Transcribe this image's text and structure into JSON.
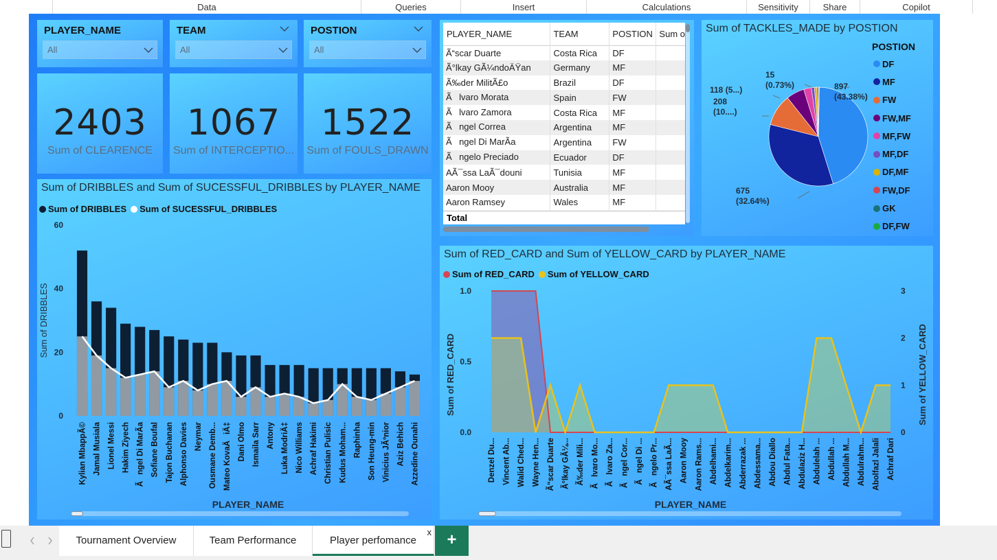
{
  "ribbon": {
    "items": [
      {
        "label": "Data"
      },
      {
        "label": "Queries"
      },
      {
        "label": "Insert"
      },
      {
        "label": "Calculations"
      },
      {
        "label": "Sensitivity"
      },
      {
        "label": "Share"
      },
      {
        "label": "Copilot"
      }
    ]
  },
  "slicers": [
    {
      "title": "PLAYER_NAME",
      "value": "All"
    },
    {
      "title": "TEAM",
      "value": "All"
    },
    {
      "title": "POSTION",
      "value": "All"
    }
  ],
  "cards": [
    {
      "value": "2403",
      "label": "Sum of CLEARENCE"
    },
    {
      "value": "1067",
      "label": "Sum of INTERCEPTIO..."
    },
    {
      "value": "1522",
      "label": "Sum of FOULS_DRAWN"
    }
  ],
  "table": {
    "headers": [
      "PLAYER_NAME",
      "TEAM",
      "POSTION",
      "Sum o"
    ],
    "rows": [
      [
        "Ã“scar Duarte",
        "Costa Rica",
        "DF"
      ],
      [
        "Ã°lkay GÃ¼ndoÄŸan",
        "Germany",
        "MF"
      ],
      [
        "Ã‰der MilitÃ£o",
        "Brazil",
        "DF"
      ],
      [
        "Ãlvaro Morata",
        "Spain",
        "FW"
      ],
      [
        "Ãlvaro Zamora",
        "Costa Rica",
        "MF"
      ],
      [
        "Ãngel Correa",
        "Argentina",
        "MF"
      ],
      [
        "Ãngel Di MarÃa",
        "Argentina",
        "FW"
      ],
      [
        "Ãngelo Preciado",
        "Ecuador",
        "DF"
      ],
      [
        "AÃ¯ssa LaÃ¯douni",
        "Tunisia",
        "MF"
      ],
      [
        "Aaron Mooy",
        "Australia",
        "MF"
      ],
      [
        "Aaron Ramsey",
        "Wales",
        "MF"
      ]
    ],
    "total_label": "Total"
  },
  "pie": {
    "title": "Sum of TACKLES_MADE by POSTION",
    "legend_title": "POSTION",
    "legend": [
      {
        "name": "DF",
        "color": "#2a8bf2"
      },
      {
        "name": "MF",
        "color": "#12239e"
      },
      {
        "name": "FW",
        "color": "#e66c37"
      },
      {
        "name": "FW,MF",
        "color": "#6b007b"
      },
      {
        "name": "MF,FW",
        "color": "#e044a7"
      },
      {
        "name": "MF,DF",
        "color": "#744ec2"
      },
      {
        "name": "DF,MF",
        "color": "#d9b300"
      },
      {
        "name": "FW,DF",
        "color": "#d64550"
      },
      {
        "name": "GK",
        "color": "#197278"
      },
      {
        "name": "DF,FW",
        "color": "#1aab40"
      }
    ],
    "labels": [
      {
        "line1": "897",
        "line2": "(43.38%)"
      },
      {
        "line1": "675",
        "line2": "(32.64%)"
      },
      {
        "line1": "208",
        "line2": "(10....)"
      },
      {
        "line1": "118 (5...)",
        "line2": ""
      },
      {
        "line1": "15",
        "line2": "(0.73%)"
      }
    ]
  },
  "bar_chart": {
    "title": "Sum of DRIBBLES and Sum of SUCESSFUL_DRIBBLES by PLAYER_NAME",
    "legend": [
      {
        "name": "Sum of DRIBBLES",
        "color": "#0d1f33"
      },
      {
        "name": "Sum of SUCESSFUL_DRIBBLES",
        "color": "#ffffff"
      }
    ],
    "ylabel": "Sum of DRIBBLES",
    "xlabel": "PLAYER_NAME",
    "yticks": [
      "60",
      "40",
      "20",
      "0"
    ]
  },
  "line_chart": {
    "title": "Sum of RED_CARD and Sum of YELLOW_CARD by PLAYER_NAME",
    "legend": [
      {
        "name": "Sum of RED_CARD",
        "color": "#d64550"
      },
      {
        "name": "Sum of YELLOW_CARD",
        "color": "#e8c21e"
      }
    ],
    "ylabel_left": "Sum of RED_CARD",
    "ylabel_right": "Sum of YELLOW_CARD",
    "xlabel": "PLAYER_NAME",
    "yticks_left": [
      "1.0",
      "0.5",
      "0.0"
    ],
    "yticks_right": [
      "3",
      "2",
      "1",
      "0"
    ]
  },
  "chart_data": [
    {
      "type": "bar",
      "title": "Sum of DRIBBLES and Sum of SUCESSFUL_DRIBBLES by PLAYER_NAME",
      "xlabel": "PLAYER_NAME",
      "ylabel": "Sum of DRIBBLES",
      "ylim": [
        0,
        60
      ],
      "categories": [
        "Kylian MbappÃ©",
        "Jamal Musiala",
        "Lionel Messi",
        "Hakim Ziyech",
        "Ãngel Di MarÃa",
        "Sofiane Boufal",
        "Tajon Buchanan",
        "Alphonso Davies",
        "Neymar",
        "Ousmane Demb...",
        "Mateo KovaÄiÄ‡",
        "Dani Olmo",
        "Ismaila Sarr",
        "Antony",
        "Luka ModriÄ‡",
        "Nico Williams",
        "Achraf Hakimi",
        "Christian Pulisic",
        "Kudus Moham...",
        "Raphinha",
        "Son Heung-min",
        "Vinicius JÃºnior",
        "Aziz Behich",
        "Azzedine Ounahi"
      ],
      "series": [
        {
          "name": "Sum of DRIBBLES",
          "values": [
            52,
            36,
            34,
            29,
            28,
            27,
            25,
            24,
            23,
            23,
            20,
            19,
            19,
            16,
            16,
            16,
            15,
            15,
            15,
            15,
            15,
            15,
            14,
            13
          ]
        },
        {
          "name": "Sum of SUCESSFUL_DRIBBLES",
          "values": [
            25,
            19,
            15,
            12,
            13,
            14,
            9,
            11,
            8,
            10,
            11,
            6,
            9,
            6,
            7,
            6,
            4,
            5,
            10,
            6,
            5,
            7,
            9,
            11
          ]
        }
      ]
    },
    {
      "type": "line",
      "title": "Sum of RED_CARD and Sum of YELLOW_CARD by PLAYER_NAME",
      "xlabel": "PLAYER_NAME",
      "ylabel": "Sum of RED_CARD",
      "ylabel_right": "Sum of YELLOW_CARD",
      "ylim": [
        0,
        1
      ],
      "ylim_right": [
        0,
        3
      ],
      "categories": [
        "Denzel Du...",
        "Vincent Ab...",
        "Walid Ched...",
        "Wayne Hen...",
        "Ã“scar Duarte",
        "Ã°lkay GÃ¼...",
        "Ã‰der Mili...",
        "Ãlvaro Mo...",
        "Ãlvaro Za...",
        "Ãngel Cor...",
        "Ãngel Di ...",
        "Ãngelo Pr...",
        "AÃ¯ssa LaÃ...",
        "Aaron Mooy",
        "Aaron Rams...",
        "Abdelhami...",
        "Abdelkarim...",
        "Abderrazak ...",
        "Abdessama...",
        "Abdou Diallo",
        "Abdul Fata...",
        "Abdulaziz H...",
        "Abdulelah ...",
        "Abdullah ...",
        "Abdullah M...",
        "Abdulrahm...",
        "Abolfazl Jalali",
        "Achraf Dari"
      ],
      "series": [
        {
          "name": "Sum of RED_CARD",
          "values": [
            1,
            1,
            1,
            1,
            0,
            0,
            0,
            0,
            0,
            0,
            0,
            0,
            0,
            0,
            0,
            0,
            0,
            0,
            0,
            0,
            0,
            0,
            0,
            0,
            0,
            0,
            0,
            0
          ]
        },
        {
          "name": "Sum of YELLOW_CARD",
          "values": [
            2,
            2,
            2,
            0,
            1,
            0,
            1,
            0,
            0,
            0,
            0,
            0,
            1,
            1,
            1,
            1,
            0,
            0,
            0,
            0,
            0,
            0,
            2,
            2,
            1,
            0,
            1,
            1
          ]
        }
      ]
    },
    {
      "type": "pie",
      "title": "Sum of TACKLES_MADE by POSTION",
      "categories": [
        "DF",
        "MF",
        "FW",
        "FW,MF",
        "MF,FW",
        "MF,DF",
        "DF,MF",
        "FW,DF",
        "GK",
        "DF,FW"
      ],
      "values": [
        897,
        675,
        208,
        118,
        50,
        20,
        15,
        10,
        5,
        2
      ]
    }
  ],
  "tabs": [
    {
      "label": "Tournament Overview"
    },
    {
      "label": "Team Performance"
    },
    {
      "label": "Player perfomance"
    }
  ],
  "tab_close": "x",
  "add_tab": "+"
}
